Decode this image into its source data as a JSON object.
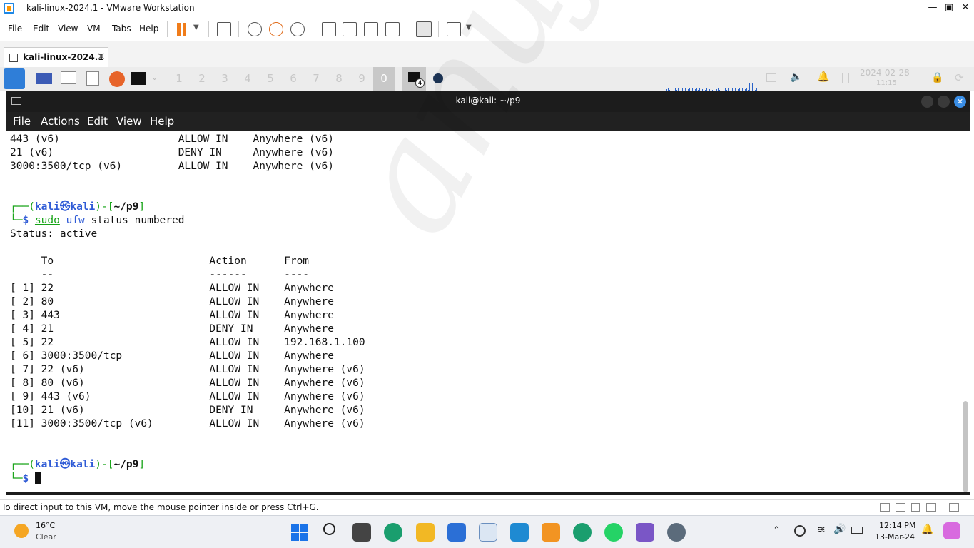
{
  "window": {
    "title": "kali-linux-2024.1 - VMware Workstation"
  },
  "vm_menu": [
    "File",
    "Edit",
    "View",
    "VM",
    "Tabs",
    "Help"
  ],
  "vm_tab": {
    "label": "kali-linux-2024.1",
    "close": "×"
  },
  "kali_panel": {
    "workspaces": [
      "1",
      "2",
      "3",
      "4",
      "5",
      "6",
      "7",
      "8",
      "9",
      "0"
    ],
    "terminal_badge": "4",
    "date": "2024-02-28",
    "time": "11:15"
  },
  "terminal": {
    "title": "kali@kali: ~/p9",
    "menu": [
      "File",
      "Actions",
      "Edit",
      "View",
      "Help"
    ],
    "lines_top": [
      "443 (v6)                   ALLOW IN    Anywhere (v6)",
      "21 (v6)                    DENY IN     Anywhere (v6)",
      "3000:3500/tcp (v6)         ALLOW IN    Anywhere (v6)"
    ],
    "prompt": {
      "user": "kali",
      "at": "㉿",
      "host": "kali",
      "path": "~/p9",
      "dollar": "$"
    },
    "command": {
      "sudo": "sudo",
      "ufw": "ufw",
      "rest": " status numbered"
    },
    "status_line": "Status: active",
    "header": "     To                         Action      From",
    "header_rule": "     --                         ------      ----",
    "rules": [
      "[ 1] 22                         ALLOW IN    Anywhere",
      "[ 2] 80                         ALLOW IN    Anywhere",
      "[ 3] 443                        ALLOW IN    Anywhere",
      "[ 4] 21                         DENY IN     Anywhere",
      "[ 5] 22                         ALLOW IN    192.168.1.100",
      "[ 6] 3000:3500/tcp              ALLOW IN    Anywhere",
      "[ 7] 22 (v6)                    ALLOW IN    Anywhere (v6)",
      "[ 8] 80 (v6)                    ALLOW IN    Anywhere (v6)",
      "[ 9] 443 (v6)                   ALLOW IN    Anywhere (v6)",
      "[10] 21 (v6)                    DENY IN     Anywhere (v6)",
      "[11] 3000:3500/tcp (v6)         ALLOW IN    Anywhere (v6)"
    ]
  },
  "watermark": "anuj.one",
  "status_bar": {
    "text": "To direct input to this VM, move the mouse pointer inside or press Ctrl+G."
  },
  "taskbar": {
    "weather_temp": "16°C",
    "weather_desc": "Clear",
    "clock_time": "12:14 PM",
    "clock_date": "13-Mar-24"
  },
  "colors": {
    "kali_blue": "#2f5bd6",
    "prompt_green": "#16a316",
    "terminal_bar": "#1c1c1c"
  }
}
